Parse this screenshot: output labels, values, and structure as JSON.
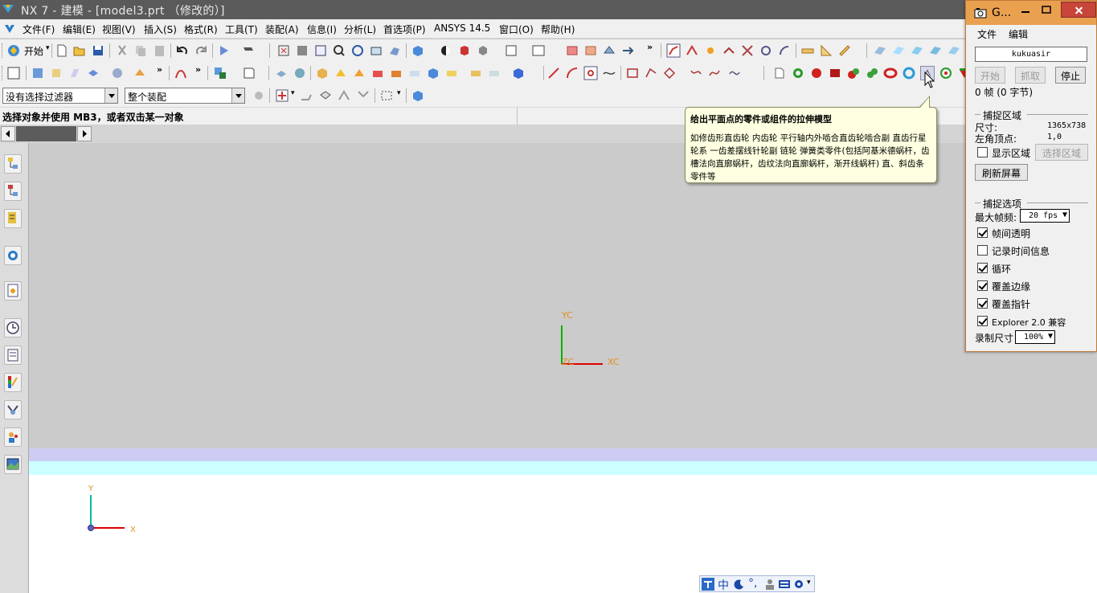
{
  "window": {
    "title": "NX 7 - 建模 - [model3.prt （修改的）]"
  },
  "menubar": {
    "items": [
      "文件(F)",
      "编辑(E)",
      "视图(V)",
      "插入(S)",
      "格式(R)",
      "工具(T)",
      "装配(A)",
      "信息(I)",
      "分析(L)",
      "首选项(P)",
      "ANSYS 14.5",
      "窗口(O)",
      "帮助(H)"
    ]
  },
  "toolbar": {
    "start_label": "开始",
    "filter_select": "没有选择过滤器",
    "assembly_select": "整个装配"
  },
  "cue": {
    "text": "选择对象并使用 MB3，或者双击某一对象"
  },
  "tooltip": {
    "title": "给出平面点的零件或组件的拉伸模型",
    "body": "如修齿形直齿轮 内齿轮 平行轴内外啮合直齿轮啮合副 直齿行星轮系 一齿差摆线针轮副 链轮 弹簧类零件(包括阿基米德蜗杆，齿槽法向直廓蜗杆，齿纹法向直廓蜗杆，渐开线蜗杆) 直、斜齿条零件等"
  },
  "viewport": {
    "wcs_y": "YC",
    "wcs_x": "XC",
    "wcs_z": "ZC",
    "abs_y": "Y",
    "abs_x": "X"
  },
  "capture": {
    "title": "G...",
    "menu_file": "文件",
    "menu_edit": "编辑",
    "user": "kukuasir",
    "btn_start": "开始",
    "btn_grab": "抓取",
    "btn_stop": "停止",
    "frames": "0 帧 (0 字节)",
    "region_group": "捕捉区域",
    "size_label": "尺寸:",
    "size_value": "1365x738",
    "topleft_label": "左角顶点:",
    "topleft_value": "1,0",
    "show_region": "显示区域",
    "select_region": "选择区域",
    "refresh": "刷新屏幕",
    "options_group": "捕捉选项",
    "max_fps_label": "最大帧频:",
    "max_fps_value": "20 fps",
    "opt_frame_transparent": "帧间透明",
    "opt_record_time": "记录时间信息",
    "opt_loop": "循环",
    "opt_cover_edge": "覆盖边缘",
    "opt_cover_cursor": "覆盖指针",
    "opt_explorer": "Explorer 2.0 兼容",
    "rec_size_label": "录制尺寸",
    "rec_size_value": "100%"
  },
  "ime": {
    "mode": "中"
  },
  "colors": {
    "title_bg": "#5a5a5a",
    "viewport_grey": "#cbcbcb",
    "band_lavender": "#ccccf4",
    "band_cyan": "#ccffff",
    "tooltip_bg": "#ffffe1",
    "capture_title": "#e9a150",
    "axis_green": "#00b000",
    "axis_red": "#e00000",
    "axis_label": "#e09020"
  }
}
